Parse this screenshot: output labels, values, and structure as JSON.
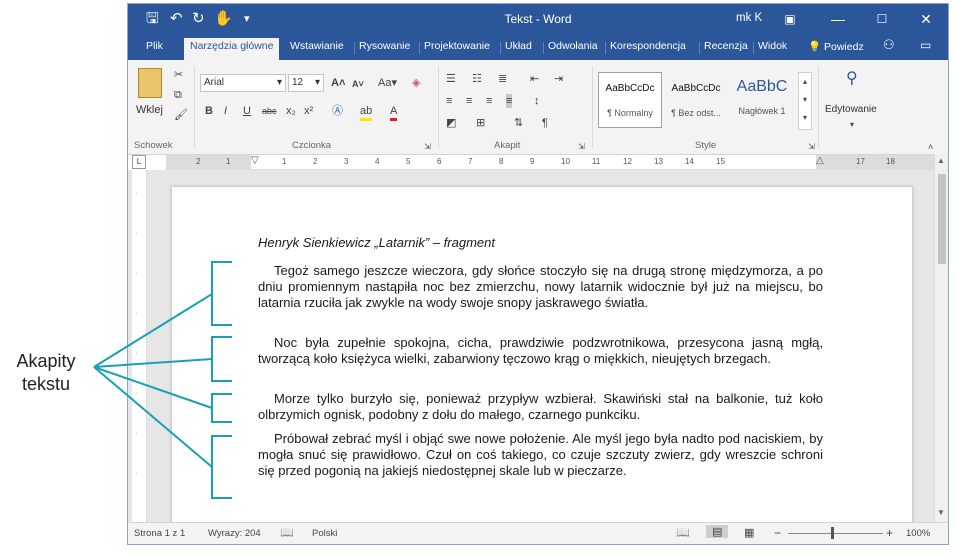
{
  "callout": {
    "line1": "Akapity",
    "line2": "tekstu"
  },
  "window": {
    "title": "Tekst - Word",
    "user": "mk K",
    "tabs": [
      "Plik",
      "Narzędzia główne",
      "Wstawianie",
      "Rysowanie",
      "Projektowanie",
      "Układ",
      "Odwołania",
      "Korespondencja",
      "Recenzja",
      "Widok",
      "Powiedz"
    ]
  },
  "ribbon": {
    "clipboard": {
      "paste": "Wklej",
      "label": "Schowek"
    },
    "font": {
      "name": "Arial",
      "size": "12",
      "label": "Czcionka",
      "case": "Aa",
      "grow": "A",
      "shrink": "A"
    },
    "paragraph": {
      "label": "Akapit"
    },
    "styles": {
      "label": "Style",
      "items": [
        {
          "preview": "AaBbCcDc",
          "name": "¶ Normalny"
        },
        {
          "preview": "AaBbCcDc",
          "name": "¶ Bez odst..."
        },
        {
          "preview": "AaBbC",
          "name": "Nagłówek 1"
        }
      ]
    },
    "editing": {
      "label": "Edytowanie"
    }
  },
  "ruler": {
    "corner": "L",
    "numbers": [
      "2",
      "1",
      "1",
      "2",
      "3",
      "4",
      "5",
      "6",
      "7",
      "8",
      "9",
      "10",
      "11",
      "12",
      "13",
      "14",
      "15",
      "17",
      "18"
    ]
  },
  "document": {
    "title": "Henryk Sienkiewicz „Latarnik” – fragment",
    "paragraphs": [
      "Tegoż samego jeszcze wieczora, gdy słońce stoczyło się na drugą stronę międzymorza, a po dniu promiennym nastąpiła noc bez zmierzchu, nowy latarnik widocznie był już na miejscu, bo latarnia rzuciła jak zwykle na wody swoje snopy jaskrawego światła.",
      "Noc była zupełnie spokojna, cicha, prawdziwie podzwrotnikowa, przesycona jasną mgłą, tworzącą koło księżyca wielki, zabarwiony tęczowo krąg o miękkich, nieujętych brzegach.",
      "Morze tylko burzyło się, ponieważ przypływ wzbierał. Skawiński stał na balkonie, tuż koło olbrzymich ognisk, podobny z dołu do małego, czarnego punkciku.",
      "Próbował zebrać myśl i objąć swe nowe położenie. Ale myśl jego była nadto pod naciskiem, by mogła snuć się prawidłowo. Czuł on coś takiego, co czuje szczuty zwierz, gdy wreszcie schroni się przed pogonią na jakiejś niedostępnej skale lub w pieczarze."
    ]
  },
  "statusbar": {
    "page": "Strona 1 z 1",
    "words": "Wyrazy: 204",
    "language": "Polski",
    "zoom": "100%"
  },
  "colors": {
    "accent": "#2b579a",
    "callout_line": "#1aa0b4"
  }
}
